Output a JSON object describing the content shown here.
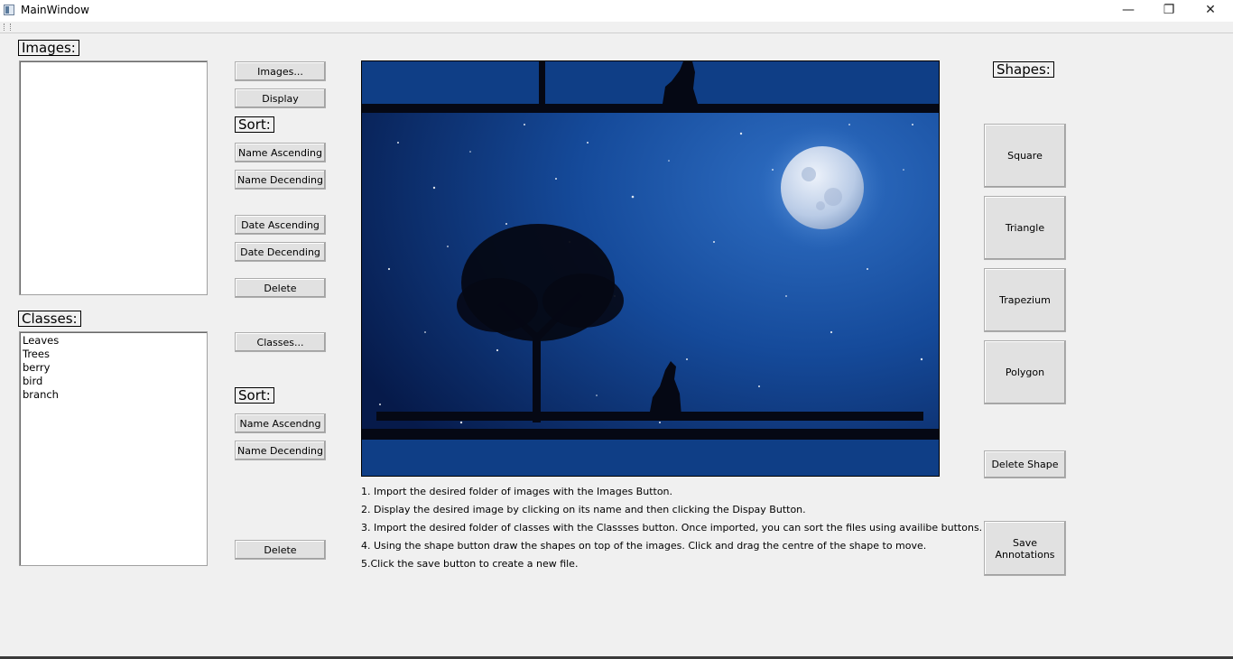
{
  "window": {
    "title": "MainWindow",
    "minimize_symbol": "—",
    "maximize_symbol": "❐",
    "close_symbol": "✕"
  },
  "images_panel": {
    "label": "Images:",
    "items": []
  },
  "classes_panel": {
    "label": "Classes:",
    "items": [
      "Leaves",
      "Trees",
      "berry",
      "bird",
      "branch"
    ]
  },
  "image_buttons": {
    "images": "Images...",
    "display": "Display",
    "sort_label": "Sort:",
    "name_ascending": "Name Ascending",
    "name_descending": "Name Decending",
    "date_ascending": "Date Ascending",
    "date_descending": "Date Decending",
    "delete": "Delete"
  },
  "class_buttons": {
    "classes": "Classes...",
    "sort_label": "Sort:",
    "name_ascending": "Name Ascendng",
    "name_descending": "Name Decending",
    "delete": "Delete"
  },
  "shapes_panel": {
    "label": "Shapes:",
    "square": "Square",
    "triangle": "Triangle",
    "trapezium": "Trapezium",
    "polygon": "Polygon",
    "delete_shape": "Delete Shape",
    "save_annotations": "Save Annotations"
  },
  "instructions": [
    "1. Import the desired folder of images with the Images Button.",
    "2. Display the desired image by clicking on its name and then clicking the Dispay Button.",
    "3. Import the desired folder of classes with the Classses button. Once imported, you can sort the files using availibe buttons.",
    "4. Using the shape button draw the shapes on top of the images. Click and drag the centre of the shape to move.",
    "5.Click the save button to create a new file."
  ],
  "colors": {
    "sky_top": "#0a1f55",
    "sky_mid": "#1553a6",
    "moon": "#c9d9ef"
  }
}
